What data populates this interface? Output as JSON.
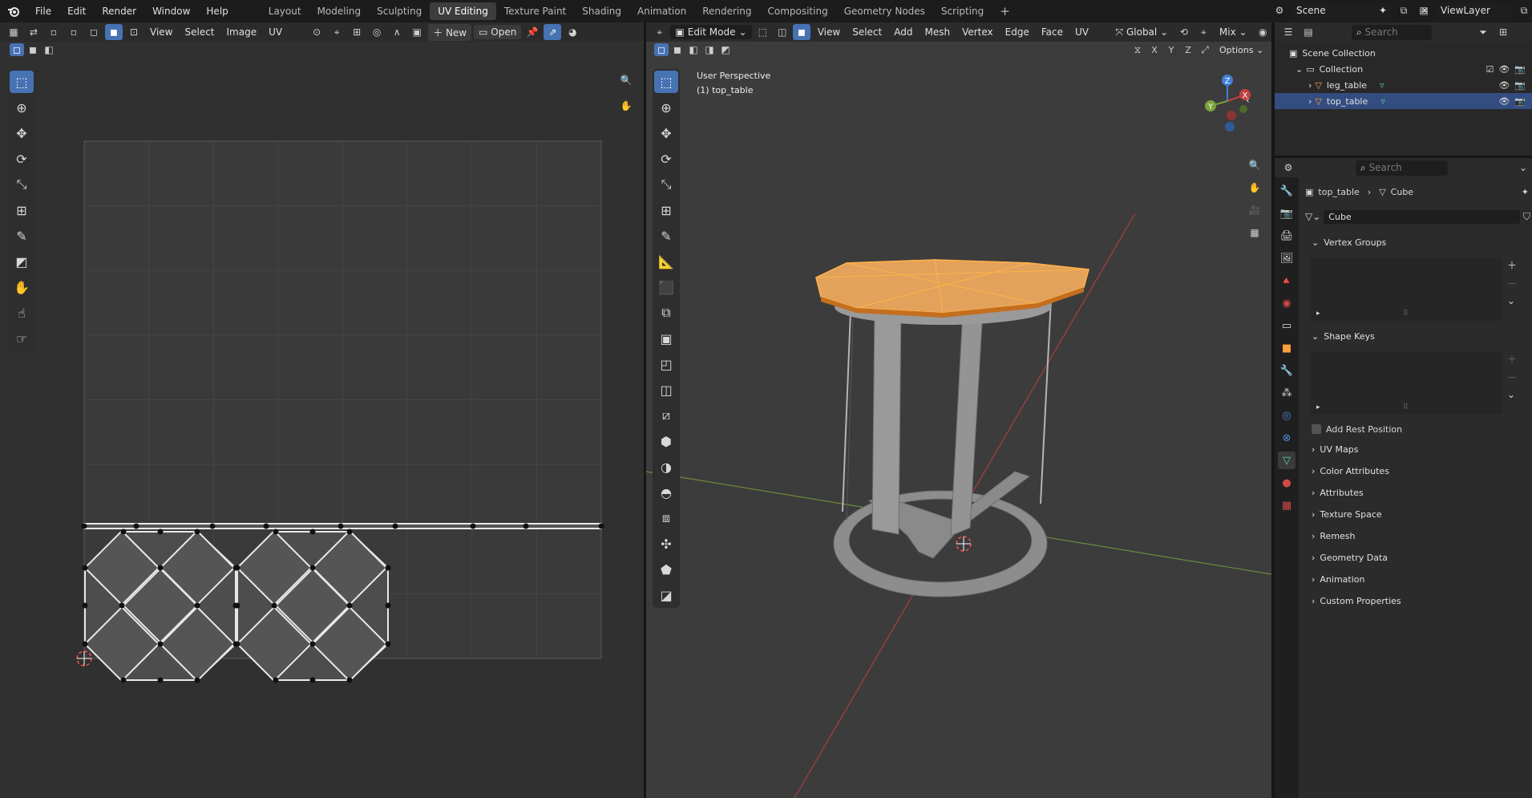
{
  "topbar": {
    "menus": [
      "File",
      "Edit",
      "Render",
      "Window",
      "Help"
    ],
    "workspaces": [
      "Layout",
      "Modeling",
      "Sculpting",
      "UV Editing",
      "Texture Paint",
      "Shading",
      "Animation",
      "Rendering",
      "Compositing",
      "Geometry Nodes",
      "Scripting"
    ],
    "active_workspace": "UV Editing",
    "add_tab": "+",
    "scene_label": "Scene",
    "viewlayer_label": "ViewLayer"
  },
  "uv_editor": {
    "menus": [
      "View",
      "Select",
      "Image",
      "UV"
    ],
    "new_label": "New",
    "open_label": "Open"
  },
  "viewport": {
    "mode_label": "Edit Mode",
    "menus": [
      "View",
      "Select",
      "Add",
      "Mesh",
      "Vertex",
      "Edge",
      "Face",
      "UV"
    ],
    "transform_orientation": "Global",
    "snap_mode": "Mix",
    "options_label": "Options",
    "overlay_title": "User Perspective",
    "overlay_object": "(1) top_table",
    "axes": {
      "x": "X",
      "y": "Y",
      "z": "Z"
    },
    "colors": {
      "selection": "#ff8a1e",
      "x_axis": "#c2403f",
      "y_axis": "#7aa33a",
      "z_axis": "#3f7fd8"
    }
  },
  "outliner": {
    "search_placeholder": "Search",
    "scene_collection": "Scene Collection",
    "collection": "Collection",
    "objects": [
      "leg_table",
      "top_table"
    ],
    "selected_object": "top_table"
  },
  "properties": {
    "search_placeholder": "Search",
    "breadcrumb_object": "top_table",
    "breadcrumb_mesh": "Cube",
    "mesh_name": "Cube",
    "panels": {
      "vertex_groups": "Vertex Groups",
      "shape_keys": "Shape Keys",
      "add_rest_position": "Add Rest Position",
      "collapsed": [
        "UV Maps",
        "Color Attributes",
        "Attributes",
        "Texture Space",
        "Remesh",
        "Geometry Data",
        "Animation",
        "Custom Properties"
      ]
    }
  }
}
